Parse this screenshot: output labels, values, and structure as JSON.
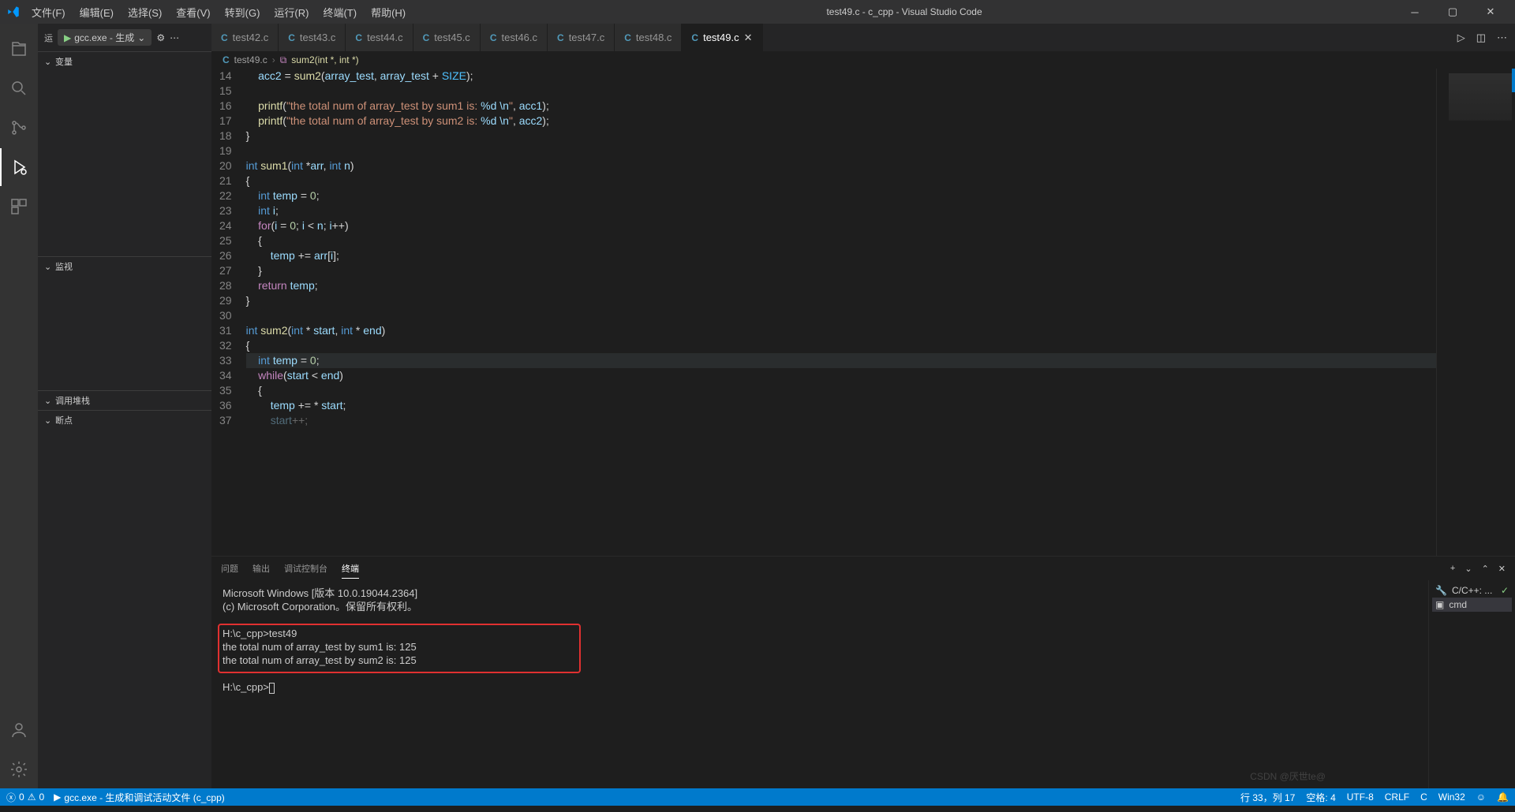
{
  "title": "test49.c - c_cpp - Visual Studio Code",
  "menu": [
    "文件(F)",
    "编辑(E)",
    "选择(S)",
    "查看(V)",
    "转到(G)",
    "运行(R)",
    "终端(T)",
    "帮助(H)"
  ],
  "run_debug": {
    "launcher_label": "gcc.exe - 生成",
    "sections": [
      "变量",
      "监视",
      "调用堆栈",
      "断点"
    ]
  },
  "tabs": [
    {
      "label": "test42.c"
    },
    {
      "label": "test43.c"
    },
    {
      "label": "test44.c"
    },
    {
      "label": "test45.c"
    },
    {
      "label": "test46.c"
    },
    {
      "label": "test47.c"
    },
    {
      "label": "test48.c"
    },
    {
      "label": "test49.c",
      "active": true
    }
  ],
  "breadcrumb": {
    "file": "test49.c",
    "symbol": "sum2(int *, int *)"
  },
  "code": {
    "first_line": 14,
    "lines": [
      {
        "html": "    <span class='id'>acc2</span> = <span class='fn'>sum2</span>(<span class='id'>array_test</span>, <span class='id'>array_test</span> + <span class='cn'>SIZE</span>);"
      },
      {
        "html": ""
      },
      {
        "html": "    <span class='fn'>printf</span>(<span class='str'>\"the total num of array_test by sum1 is: <span class='spec'>%d</span> <span class='spec'>\\n</span>\"</span>, <span class='id'>acc1</span>);"
      },
      {
        "html": "    <span class='fn'>printf</span>(<span class='str'>\"the total num of array_test by sum2 is: <span class='spec'>%d</span> <span class='spec'>\\n</span>\"</span>, <span class='id'>acc2</span>);"
      },
      {
        "html": "}"
      },
      {
        "html": ""
      },
      {
        "html": "<span class='ty'>int</span> <span class='fn'>sum1</span>(<span class='ty'>int</span> *<span class='id'>arr</span>, <span class='ty'>int</span> <span class='id'>n</span>)"
      },
      {
        "html": "{"
      },
      {
        "html": "    <span class='ty'>int</span> <span class='id'>temp</span> = <span class='num'>0</span>;"
      },
      {
        "html": "    <span class='ty'>int</span> <span class='id'>i</span>;"
      },
      {
        "html": "    <span class='ctrl'>for</span>(<span class='id'>i</span> = <span class='num'>0</span>; <span class='id'>i</span> &lt; <span class='id'>n</span>; <span class='id'>i</span>++)"
      },
      {
        "html": "    {"
      },
      {
        "html": "        <span class='id'>temp</span> += <span class='id'>arr</span>[<span class='id'>i</span>];"
      },
      {
        "html": "    }"
      },
      {
        "html": "    <span class='ctrl'>return</span> <span class='id'>temp</span>;"
      },
      {
        "html": "}"
      },
      {
        "html": ""
      },
      {
        "html": "<span class='ty'>int</span> <span class='fn'>sum2</span>(<span class='ty'>int</span> * <span class='id'>start</span>, <span class='ty'>int</span> * <span class='id'>end</span>)"
      },
      {
        "html": "{"
      },
      {
        "html": "    <span class='ty'>int</span> <span class='id'>temp</span> = <span class='num'>0</span>;",
        "hl": true
      },
      {
        "html": "    <span class='ctrl'>while</span>(<span class='id'>start</span> &lt; <span class='id'>end</span>)"
      },
      {
        "html": "    {"
      },
      {
        "html": "        <span class='id'>temp</span> += * <span class='id'>start</span>;"
      },
      {
        "html": "        <span class='id'>start</span>++;",
        "dim": true
      }
    ]
  },
  "panel": {
    "tabs": [
      "问题",
      "输出",
      "调试控制台",
      "终端"
    ],
    "active_tab": 3,
    "terminal_lines": [
      "Microsoft Windows [版本 10.0.19044.2364]",
      "(c) Microsoft Corporation。保留所有权利。",
      "",
      "H:\\c_cpp>test49",
      "the total num of array_test by sum1 is: 125",
      "the total num of array_test by sum2 is: 125",
      "",
      "H:\\c_cpp>"
    ],
    "side": [
      {
        "label": "C/C++: ...",
        "icon": "wrench",
        "check": true
      },
      {
        "label": "cmd",
        "icon": "terminal",
        "active": true
      }
    ]
  },
  "status": {
    "errors": "0",
    "warnings": "0",
    "task": "gcc.exe - 生成和调试活动文件 (c_cpp)",
    "pos": "行 33，列 17",
    "spaces": "空格: 4",
    "enc": "UTF-8",
    "eol": "CRLF",
    "lang": "C",
    "os": "Win32",
    "bell": "🔔"
  },
  "watermark": "CSDN @厌世te@"
}
